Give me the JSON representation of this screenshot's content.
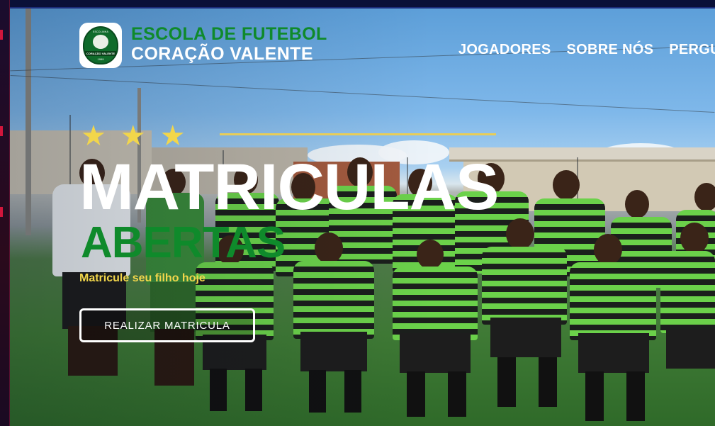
{
  "brand": {
    "line1": "ESCOLA DE FUTEBOL",
    "line2": "CORAÇÃO VALENTE",
    "logo": {
      "top_text": "ESCOLINHA",
      "band_text": "CORAÇÃO VALENTE",
      "year": "1999",
      "icon": "lion-crest-icon"
    }
  },
  "nav": {
    "items": [
      "JOGADORES",
      "SOBRE NÓS",
      "PERGU"
    ]
  },
  "hero": {
    "stars": [
      "★",
      "★",
      "★"
    ],
    "headline": "MATRICULAS",
    "subheadline": "ABERTAS",
    "tagline": "Matricule seu filho hoje",
    "cta_label": "REALIZAR MATRICULA"
  },
  "colors": {
    "brand_green": "#0f8a2b",
    "gold": "#f2d64b",
    "white": "#ffffff",
    "top_bar": "#0a1038"
  }
}
